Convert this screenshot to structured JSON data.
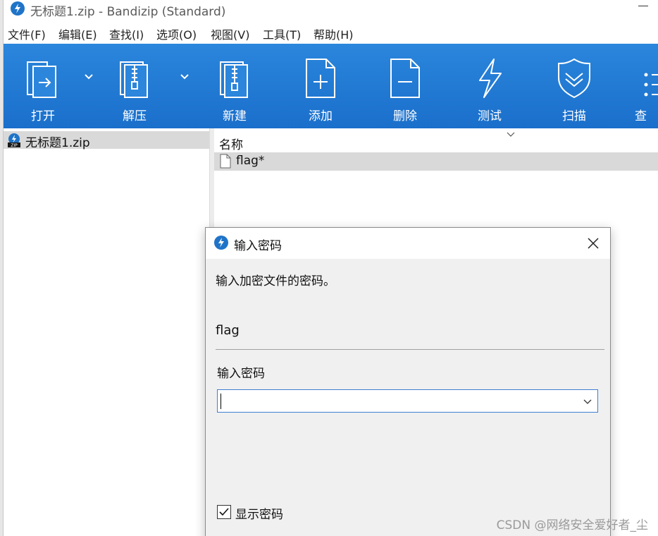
{
  "window": {
    "title": "无标题1.zip - Bandizip (Standard)"
  },
  "menu": [
    {
      "label": "文件(F)"
    },
    {
      "label": "编辑(E)"
    },
    {
      "label": "查找(I)"
    },
    {
      "label": "选项(O)"
    },
    {
      "label": "视图(V)"
    },
    {
      "label": "工具(T)"
    },
    {
      "label": "帮助(H)"
    }
  ],
  "toolbar": {
    "items": [
      {
        "label": "打开",
        "icon": "open-icon"
      },
      {
        "label": "解压",
        "icon": "extract-icon"
      },
      {
        "label": "新建",
        "icon": "new-archive-icon"
      },
      {
        "label": "添加",
        "icon": "add-file-icon"
      },
      {
        "label": "删除",
        "icon": "delete-file-icon"
      },
      {
        "label": "测试",
        "icon": "test-bolt-icon"
      },
      {
        "label": "扫描",
        "icon": "scan-shield-icon"
      },
      {
        "label": "查",
        "icon": "view-list-icon"
      }
    ],
    "background": "#1f77d0"
  },
  "tree": {
    "items": [
      {
        "label": "无标题1.zip",
        "icon": "zip-archive-icon"
      }
    ]
  },
  "file_list": {
    "columns": [
      {
        "label": "名称"
      }
    ],
    "rows": [
      {
        "name": "flag*",
        "icon": "file-icon"
      }
    ]
  },
  "dialog": {
    "title": "输入密码",
    "message": "输入加密文件的密码。",
    "filename": "flag",
    "password_label": "输入密码",
    "password_value": "",
    "show_password_label": "显示密码",
    "show_password_checked": true
  },
  "watermark": "CSDN @网络安全爱好者_尘",
  "colors": {
    "accent": "#1f74c8",
    "selection": "#d9d9d9",
    "dialog_bg": "#f0f0f0"
  }
}
